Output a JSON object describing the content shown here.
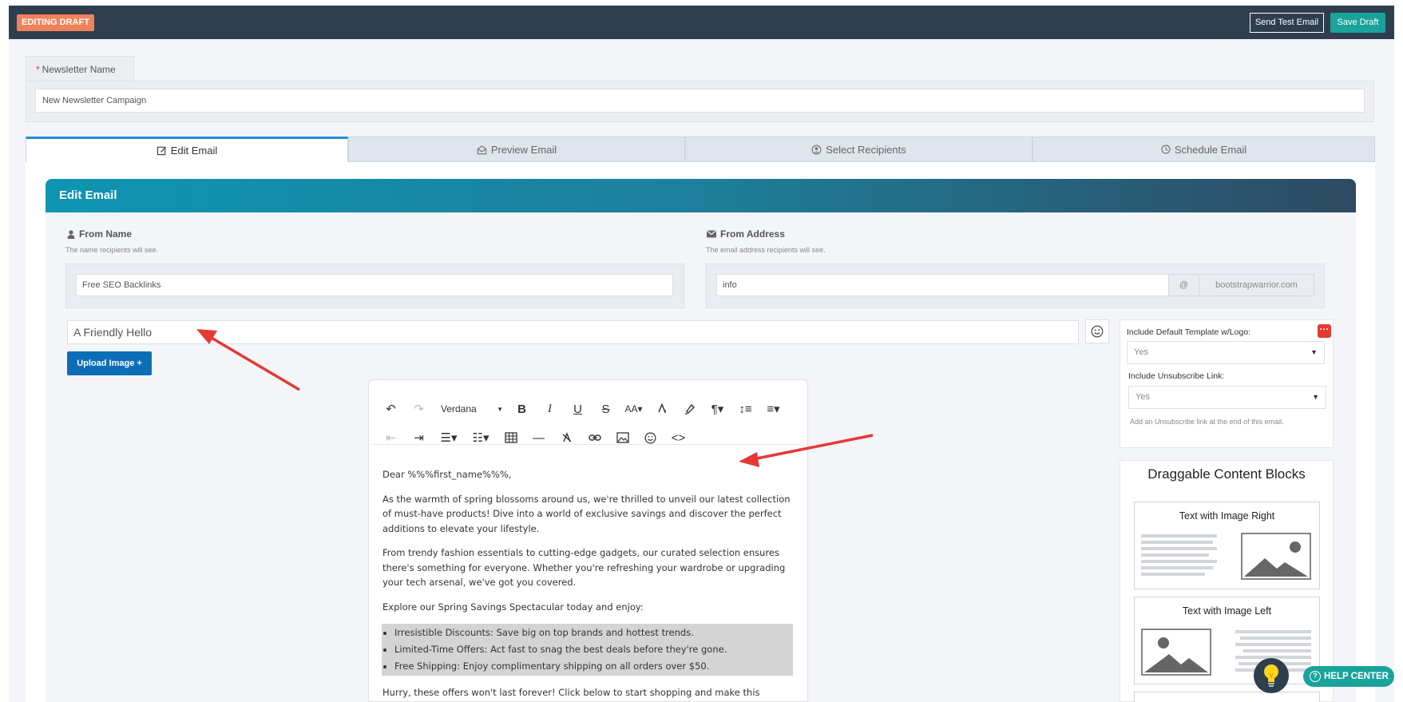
{
  "topbar": {
    "status_badge": "EDITING DRAFT",
    "send_test_label": "Send Test Email",
    "save_draft_label": "Save Draft"
  },
  "newsletter": {
    "tab_label": "Newsletter Name",
    "required_mark": "*",
    "value": "New Newsletter Campaign"
  },
  "tabs": [
    {
      "label": "Edit Email",
      "icon": "edit-icon"
    },
    {
      "label": "Preview Email",
      "icon": "envelope-open-icon"
    },
    {
      "label": "Select Recipients",
      "icon": "user-circle-icon"
    },
    {
      "label": "Schedule Email",
      "icon": "clock-icon"
    }
  ],
  "edit_email": {
    "header": "Edit Email",
    "from_name": {
      "label": "From Name",
      "help": "The name recipients will see.",
      "value": "Free SEO Backlinks"
    },
    "from_address": {
      "label": "From Address",
      "help": "The email address recipients will see.",
      "value": "info",
      "at": "@",
      "domain": "bootstrapwarrior.com"
    },
    "subject": "A Friendly Hello",
    "upload_label": "Upload Image",
    "upload_plus": "+"
  },
  "editor": {
    "font": "Verdana",
    "greeting": "Dear %%%first_name%%%,",
    "para1": "As the warmth of spring blossoms around us, we're thrilled to unveil our latest collection of must-have products! Dive into a world of exclusive savings and discover the perfect additions to elevate your lifestyle.",
    "para2": "From trendy fashion essentials to cutting-edge gadgets, our curated selection ensures there's something for everyone. Whether you're refreshing your wardrobe or upgrading your tech arsenal, we've got you covered.",
    "para3": "Explore our Spring Savings Spectacular today and enjoy:",
    "bullets": [
      "Irresistible Discounts: Save big on top brands and hottest trends.",
      "Limited-Time Offers: Act fast to snag the best deals before they're gone.",
      "Free Shipping: Enjoy complimentary shipping on all orders over $50."
    ],
    "para4": "Hurry, these offers won't last forever! Click below to start shopping and make this"
  },
  "sidebar": {
    "template_label": "Include Default Template w/Logo:",
    "template_value": "Yes",
    "unsub_label": "Include Unsubscribe Link:",
    "unsub_value": "Yes",
    "unsub_help": "Add an Unsubscribe link at the end of this email.",
    "blocks_title": "Draggable Content Blocks",
    "blocks": [
      {
        "title": "Text with Image Right"
      },
      {
        "title": "Text with Image Left"
      }
    ]
  },
  "help": {
    "label": "HELP CENTER",
    "icon_glyph": "?"
  },
  "colors": {
    "topbar": "#2e3e4e",
    "accent": "#1aa39b",
    "badge": "#f0825a",
    "header_start": "#0e95b2",
    "header_end": "#2e4a62",
    "primary_button": "#0d6eb8",
    "annotation_arrow": "#e53935"
  }
}
